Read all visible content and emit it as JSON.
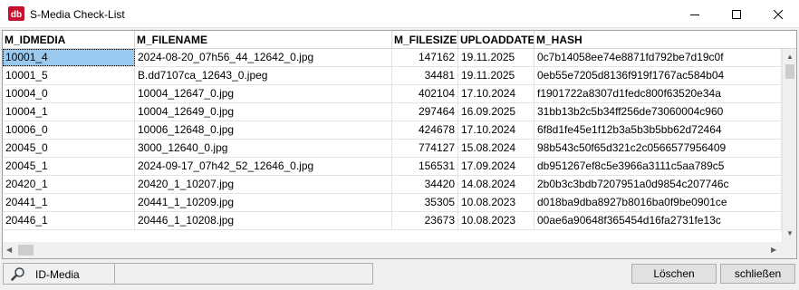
{
  "window": {
    "title": "S-Media Check-List"
  },
  "grid": {
    "columns": [
      "M_IDMEDIA",
      "M_FILENAME",
      "M_FILESIZE",
      "UPLOADDATE",
      "M_HASH"
    ],
    "rows": [
      [
        "10001_4",
        "2024-08-20_07h56_44_12642_0.jpg",
        "147162",
        "19.11.2025",
        "0c7b14058ee74e8871fd792be7d19c0f"
      ],
      [
        "10001_5",
        "B.dd7107ca_12643_0.jpeg",
        "34481",
        "19.11.2025",
        "0eb55e7205d8136f919f1767ac584b04"
      ],
      [
        "10004_0",
        "10004_12647_0.jpg",
        "402104",
        "17.10.2024",
        "f1901722a8307d1fedc800f63520e34a"
      ],
      [
        "10004_1",
        "10004_12649_0.jpg",
        "297464",
        "16.09.2025",
        "31bb13b2c5b34ff256de73060004c960"
      ],
      [
        "10006_0",
        "10006_12648_0.jpg",
        "424678",
        "17.10.2024",
        "6f8d1fe45e1f12b3a5b3b5bb62d72464"
      ],
      [
        "20045_0",
        "3000_12640_0.jpg",
        "774127",
        "15.08.2024",
        "98b543c50f65d321c2c0566577956409"
      ],
      [
        "20045_1",
        "2024-09-17_07h42_52_12646_0.jpg",
        "156531",
        "17.09.2024",
        "db951267ef8c5e3966a3111c5aa789c5"
      ],
      [
        "20420_1",
        "20420_1_10207.jpg",
        "34420",
        "14.08.2024",
        "2b0b3c3bdb7207951a0d9854c207746c"
      ],
      [
        "20441_1",
        "20441_1_10209.jpg",
        "35305",
        "10.08.2023",
        "d018ba9dba8927b8016ba0f9be0901ce"
      ],
      [
        "20446_1",
        "20446_1_10208.jpg",
        "23673",
        "10.08.2023",
        "00ae6a90648f365454d16fa2731fe13c"
      ]
    ]
  },
  "status": {
    "label": "ID-Media",
    "icon": "magnifier-icon"
  },
  "buttons": {
    "delete": "Löschen",
    "close": "schließen"
  },
  "colors": {
    "selection": "#99c9ef",
    "app_icon": "#c8102e"
  }
}
